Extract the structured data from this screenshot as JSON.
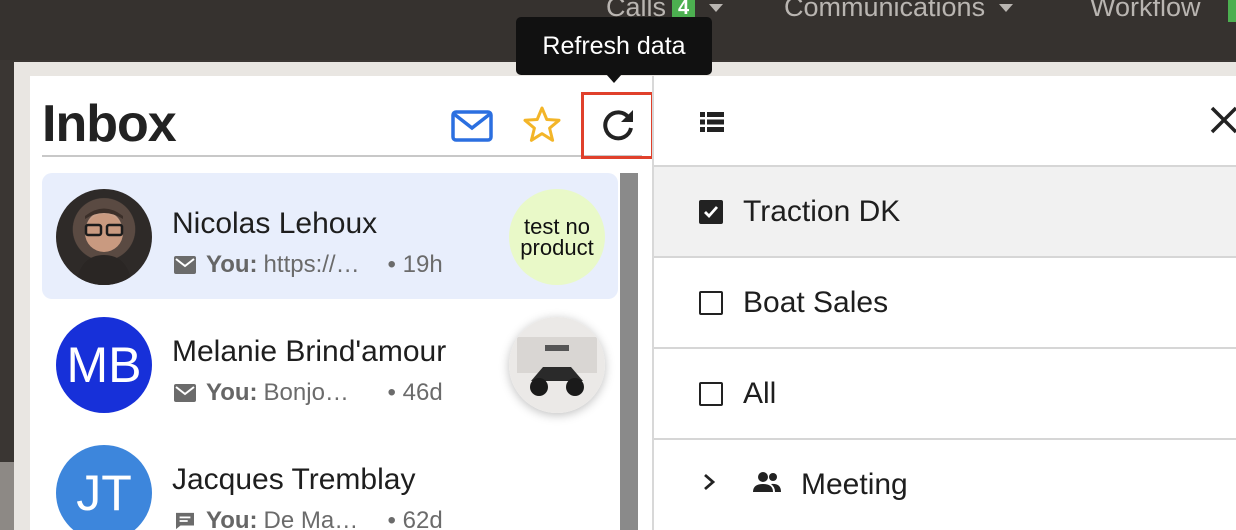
{
  "topnav": {
    "calls_label": "Calls",
    "calls_badge": "4",
    "communications_label": "Communications",
    "workflow_label": "Workflow"
  },
  "inbox": {
    "title": "Inbox",
    "tooltip": "Refresh data",
    "conversations": [
      {
        "name": "Nicolas Lehoux",
        "you": "You:",
        "preview": "https://…",
        "time": "• 19h",
        "channel_icon": "mail-icon",
        "product": "test no product",
        "selected": true
      },
      {
        "name": "Melanie Brind'amour",
        "initials": "MB",
        "you": "You:",
        "preview": "Bonjo…",
        "time": "• 46d",
        "channel_icon": "mail-icon",
        "product_image": "atv-photo"
      },
      {
        "name": "Jacques Tremblay",
        "initials": "JT",
        "you": "You:",
        "preview": "De Ma…",
        "time": "• 62d",
        "channel_icon": "chat-icon"
      }
    ]
  },
  "filters": {
    "items": [
      {
        "label": "Traction DK",
        "checked": true
      },
      {
        "label": "Boat Sales",
        "checked": false
      },
      {
        "label": "All",
        "checked": false
      }
    ],
    "group": {
      "label": "Meeting",
      "icon": "people-icon"
    }
  },
  "colors": {
    "accent_red": "#e0402b",
    "mail_blue": "#2b6fe0",
    "star_yellow": "#f3b528",
    "badge_green": "#4caf50",
    "selected_bg": "#e8eefc",
    "mb_avatar": "#1730d9",
    "jt_avatar": "#3d86dc"
  }
}
